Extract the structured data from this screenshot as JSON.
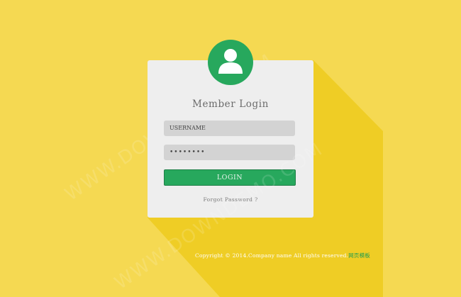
{
  "login": {
    "title": "Member Login",
    "username_value": "USERNAME",
    "password_value": "••••••••",
    "login_label": "LOGIN",
    "forgot_label": "Forgot Password ?"
  },
  "footer": {
    "copyright_text": "Copyright © 2014.Company name All rights reserved.",
    "link_text": "网页模板"
  },
  "watermark": {
    "text": "WWW.DOWNDEMO.COM"
  },
  "colors": {
    "background": "#f5d952",
    "shadow": "#efcd25",
    "card": "#eeeeee",
    "accent": "#27a85d",
    "field": "#d3d3d3"
  },
  "icons": {
    "avatar": "user-icon"
  }
}
